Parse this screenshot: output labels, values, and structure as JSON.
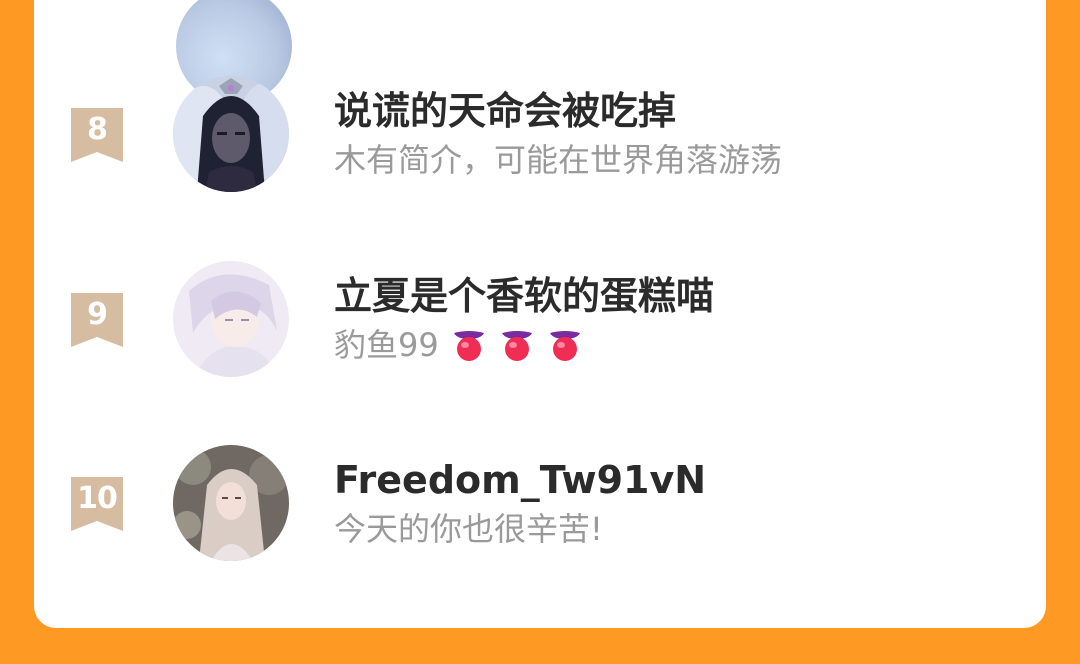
{
  "colors": {
    "background": "#FE9A24",
    "card": "#FFFFFF",
    "name_text": "#2B2B2B",
    "bio_text": "#9A9A9A",
    "rank_badge": "#D6BDA1"
  },
  "ranking": {
    "entries": [
      {
        "rank": "8",
        "name": "说谎的天命会被吃掉",
        "bio": "木有简介，可能在世界角落游荡",
        "avatar": "anime-dark-hair-avatar"
      },
      {
        "rank": "9",
        "name": "立夏是个香软的蛋糕喵",
        "bio": "豹鱼99",
        "bio_emojis": [
          "tongue-emoji",
          "tongue-emoji",
          "tongue-emoji"
        ],
        "avatar": "anime-white-hair-avatar"
      },
      {
        "rank": "10",
        "name": "Freedom_Tw91vN",
        "bio": "今天的你也很辛苦!",
        "avatar": "girl-photo-avatar"
      }
    ]
  }
}
